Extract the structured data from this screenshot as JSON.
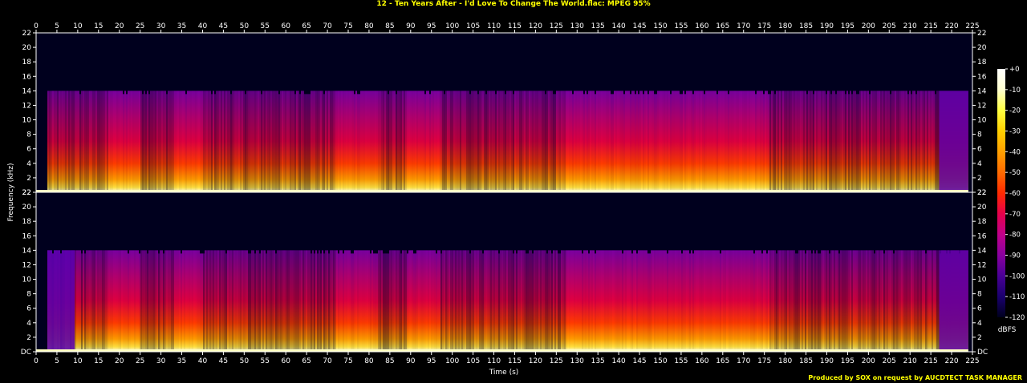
{
  "title": "12 - Ten Years After - I'd Love To Change The World.flac: MPEG 95%",
  "credit": "Produced by SOX on request by AUCDTECT TASK MANAGER",
  "colors": {
    "title": "#ffff00",
    "text": "#ffffff",
    "background": "#000000",
    "plot_bg": "#00001e"
  },
  "chart_data": {
    "type": "heatmap",
    "xlabel": "Time (s)",
    "ylabel": "Frequency (kHz)",
    "xlim": [
      0,
      225
    ],
    "x_ticks": [
      0,
      5,
      10,
      15,
      20,
      25,
      30,
      35,
      40,
      45,
      50,
      55,
      60,
      65,
      70,
      75,
      80,
      85,
      90,
      95,
      100,
      105,
      110,
      115,
      120,
      125,
      130,
      135,
      140,
      145,
      150,
      155,
      160,
      165,
      170,
      175,
      180,
      185,
      190,
      195,
      200,
      205,
      210,
      215,
      220,
      225
    ],
    "panels": [
      {
        "name": "",
        "ylim": [
          0,
          22
        ],
        "y_ticks": [
          {
            "v": 0,
            "label": "22"
          },
          {
            "v": 2,
            "label": "2"
          },
          {
            "v": 4,
            "label": "4"
          },
          {
            "v": 6,
            "label": "6"
          },
          {
            "v": 8,
            "label": "8"
          },
          {
            "v": 10,
            "label": "10"
          },
          {
            "v": 12,
            "label": "12"
          },
          {
            "v": 14,
            "label": "14"
          },
          {
            "v": 16,
            "label": "16"
          },
          {
            "v": 18,
            "label": "18"
          },
          {
            "v": 20,
            "label": "20"
          },
          {
            "v": 22,
            "label": "22"
          }
        ]
      },
      {
        "name": "",
        "ylim": [
          0,
          22
        ],
        "y_ticks": [
          {
            "v": 0,
            "label": "DC"
          },
          {
            "v": 2,
            "label": "2"
          },
          {
            "v": 4,
            "label": "4"
          },
          {
            "v": 6,
            "label": "6"
          },
          {
            "v": 8,
            "label": "8"
          },
          {
            "v": 10,
            "label": "10"
          },
          {
            "v": 12,
            "label": "12"
          },
          {
            "v": 14,
            "label": "14"
          },
          {
            "v": 16,
            "label": "16"
          },
          {
            "v": 18,
            "label": "18"
          },
          {
            "v": 20,
            "label": "20"
          },
          {
            "v": 22,
            "label": "22"
          }
        ]
      }
    ],
    "lowpass_cutoff_khz": 14,
    "audio_end_s": 224,
    "colorbar": {
      "label": "dBFS",
      "range": [
        -120,
        0
      ],
      "ticks": [
        "+0",
        "-10",
        "-20",
        "-30",
        "-40",
        "-50",
        "-60",
        "-70",
        "-80",
        "-90",
        "-100",
        "-110",
        "-120"
      ],
      "tick_values": [
        0,
        -10,
        -20,
        -30,
        -40,
        -50,
        -60,
        -70,
        -80,
        -90,
        -100,
        -110,
        -120
      ],
      "colormap": [
        "#00001e",
        "#1a006e",
        "#4a0096",
        "#8a00a0",
        "#c0008a",
        "#e6004a",
        "#ff2a00",
        "#ff6a00",
        "#ffa000",
        "#ffd000",
        "#ffff40",
        "#ffffd0",
        "#ffffff"
      ]
    },
    "loud_segments_s": [
      [
        17,
        25
      ],
      [
        33,
        40
      ],
      [
        72,
        82
      ],
      [
        89,
        97
      ],
      [
        127,
        176
      ]
    ],
    "quiet_segments_s": [
      [
        0,
        9
      ]
    ]
  }
}
